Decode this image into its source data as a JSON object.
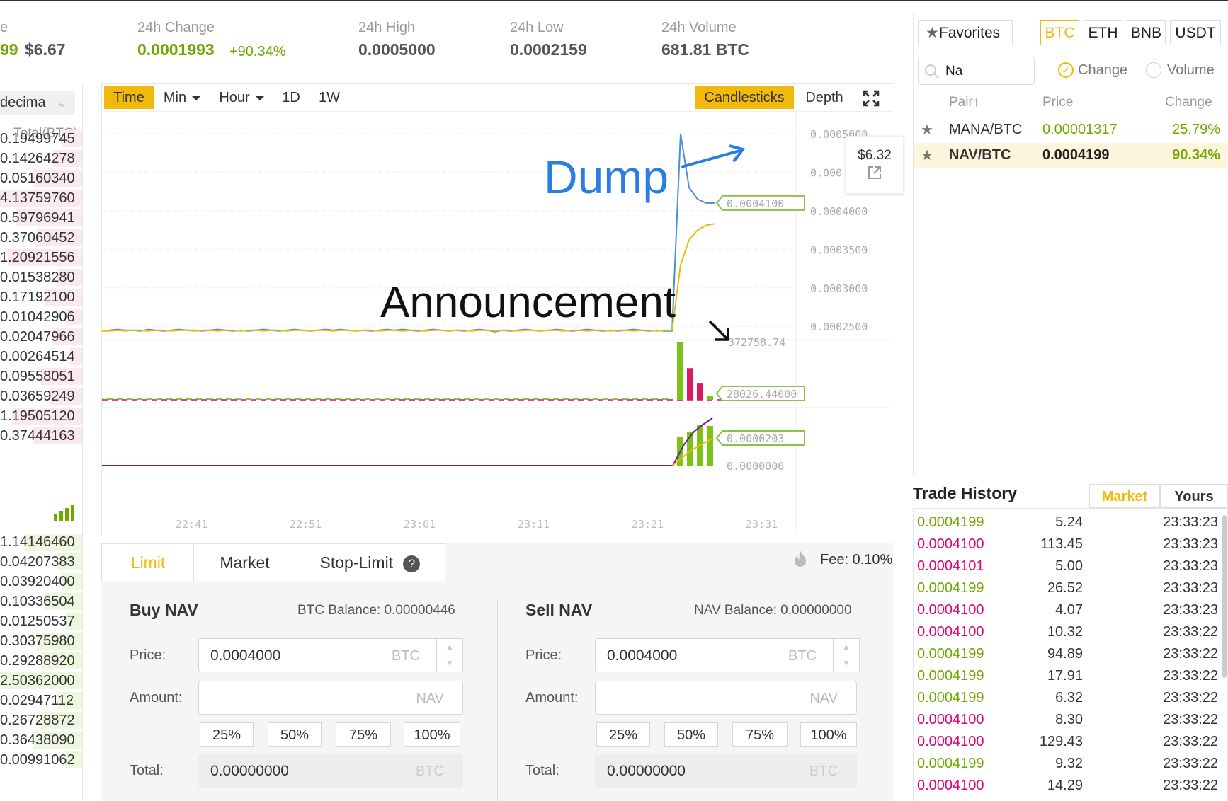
{
  "ticker": {
    "last_price_partial": "99",
    "last_price_usd": "$6.67",
    "change_label": "24h Change",
    "change_value": "0.0001993",
    "change_pct": "+90.34%",
    "high_label": "24h High",
    "high_value": "0.0005000",
    "low_label": "24h Low",
    "low_value": "0.0002159",
    "volume_label": "24h Volume",
    "volume_value": "681.81 BTC",
    "first_label_partial": "e"
  },
  "orderbook": {
    "decimals_label": "decima",
    "total_header": "Total(BTC)",
    "asks": [
      "0.19499745",
      "0.14264278",
      "0.05160340",
      "4.13759760",
      "0.59796941",
      "0.37060452",
      "1.20921556",
      "0.01538280",
      "0.17192100",
      "0.01042906",
      "0.02047966",
      "0.00264514",
      "0.09558051",
      "0.03659249",
      "1.19505120",
      "0.37444163"
    ],
    "bids": [
      "1.14146460",
      "0.04207383",
      "0.03920400",
      "0.10336504",
      "0.01250537",
      "0.30375980",
      "0.29288920",
      "2.50362000",
      "0.02947112",
      "0.26728872",
      "0.36438090",
      "0.00991062"
    ]
  },
  "chart_toolbar": {
    "time": "Time",
    "min": "Min",
    "hour": "Hour",
    "d1": "1D",
    "w1": "1W",
    "candlesticks": "Candlesticks",
    "depth": "Depth",
    "fullscreen_icon": "expand-icon"
  },
  "chart_data": {
    "type": "line",
    "x_ticks": [
      "22:41",
      "22:51",
      "23:01",
      "23:11",
      "23:21",
      "23:31"
    ],
    "price_ticks": [
      "0.0005000",
      "0.000",
      "0.0004000",
      "0.0003500",
      "0.0003000",
      "0.0002500"
    ],
    "price_ylim": [
      0.00023,
      0.00051
    ],
    "series": [
      {
        "color": "#4a90d9",
        "values": [
          0.000244,
          0.000245,
          0.000246,
          0.000245,
          0.000245,
          0.000244,
          0.000246,
          0.000245,
          0.000244,
          0.000245,
          0.000246,
          0.000245,
          0.000245,
          0.000244,
          0.000245,
          0.000246,
          0.000245,
          0.000244,
          0.000245,
          0.000244,
          0.000245,
          0.000246,
          0.000245,
          0.000244,
          0.000245,
          0.000246,
          0.000245,
          0.000244,
          0.000245,
          0.000246,
          0.000245,
          0.000246,
          0.000245,
          0.000244,
          0.000245,
          0.000244,
          0.000245,
          0.000246,
          0.000245,
          0.000246,
          0.000245,
          0.000244,
          0.000245,
          0.000246,
          0.000245,
          0.000244,
          0.000245,
          0.000244,
          0.000245,
          0.000246,
          0.000245,
          0.000243,
          0.000245,
          0.000244,
          0.000245,
          0.000246,
          0.000245,
          0.000244,
          0.000245,
          0.000246,
          0.000245,
          0.000244,
          0.000245,
          0.000246,
          0.000245,
          0.000244,
          0.000245,
          0.000244,
          0.000245,
          0.000246,
          0.000245,
          0.000244,
          0.000245,
          0.000244,
          0.000244,
          0.0005,
          0.00043,
          0.000415,
          0.00041,
          0.00041
        ]
      },
      {
        "color": "#f0b90b",
        "values": [
          0.000244,
          0.000244,
          0.000245,
          0.000244,
          0.000245,
          0.000245,
          0.000244,
          0.000245,
          0.000245,
          0.000244,
          0.000245,
          0.000245,
          0.000244,
          0.000245,
          0.000245,
          0.000244,
          0.000245,
          0.000245,
          0.000244,
          0.000245,
          0.000245,
          0.000244,
          0.000245,
          0.000245,
          0.000244,
          0.000245,
          0.000245,
          0.000244,
          0.000245,
          0.000245,
          0.000244,
          0.000245,
          0.000245,
          0.000244,
          0.000245,
          0.000245,
          0.000244,
          0.000245,
          0.000245,
          0.000244,
          0.000245,
          0.000245,
          0.000244,
          0.000245,
          0.000245,
          0.000244,
          0.000245,
          0.000245,
          0.000244,
          0.000245,
          0.000245,
          0.000244,
          0.000245,
          0.000245,
          0.000244,
          0.000245,
          0.000245,
          0.000244,
          0.000245,
          0.000245,
          0.000244,
          0.000245,
          0.000245,
          0.000244,
          0.000245,
          0.000245,
          0.000244,
          0.000245,
          0.000245,
          0.000244,
          0.000245,
          0.000245,
          0.000244,
          0.000245,
          0.000245,
          0.00033,
          0.000362,
          0.000375,
          0.000381,
          0.000383
        ]
      }
    ],
    "current_price_label": "0.0004100",
    "volume_ticks": [
      "372758.74",
      "28026.44000"
    ],
    "volume_bars": [
      372758.74,
      206000,
      110000,
      28026.44
    ],
    "indicator_ticks": [
      "0.0000203",
      "0.0000000"
    ],
    "tooltip_price": "$6.32",
    "annotation_dump": "Dump",
    "annotation_announcement": "Announcement"
  },
  "order_form": {
    "tabs": [
      "Limit",
      "Market",
      "Stop-Limit"
    ],
    "help_icon": "?",
    "fee": "Fee: 0.10%",
    "buy": {
      "title": "Buy NAV",
      "balance": "BTC Balance: 0.00000446",
      "price_label": "Price:",
      "price": "0.0004000",
      "price_unit": "BTC",
      "amount_label": "Amount:",
      "amount_unit": "NAV",
      "total_label": "Total:",
      "total": "0.00000000",
      "total_unit": "BTC"
    },
    "sell": {
      "title": "Sell NAV",
      "balance": "NAV Balance: 0.00000000",
      "price_label": "Price:",
      "price": "0.0004000",
      "price_unit": "BTC",
      "amount_label": "Amount:",
      "amount_unit": "NAV",
      "total_label": "Total:",
      "total": "0.00000000",
      "total_unit": "BTC"
    },
    "percents": [
      "25%",
      "50%",
      "75%",
      "100%"
    ]
  },
  "market_panel": {
    "favorites": "Favorites",
    "markets": [
      "BTC",
      "ETH",
      "BNB",
      "USDT"
    ],
    "search_value": "Na",
    "change_radio": "Change",
    "volume_radio": "Volume",
    "headers": {
      "pair": "Pair",
      "price": "Price",
      "change": "Change"
    },
    "rows": [
      {
        "pair": "MANA/BTC",
        "price": "0.00001317",
        "change": "25.79%"
      },
      {
        "pair": "NAV/BTC",
        "price": "0.0004199",
        "change": "90.34%"
      }
    ]
  },
  "trade_history": {
    "title": "Trade History",
    "tabs": [
      "Market",
      "Yours"
    ],
    "rows": [
      {
        "price": "0.0004199",
        "amount": "5.24",
        "time": "23:33:23",
        "side": "buy"
      },
      {
        "price": "0.0004100",
        "amount": "113.45",
        "time": "23:33:23",
        "side": "sell"
      },
      {
        "price": "0.0004101",
        "amount": "5.00",
        "time": "23:33:23",
        "side": "sell"
      },
      {
        "price": "0.0004199",
        "amount": "26.52",
        "time": "23:33:23",
        "side": "buy"
      },
      {
        "price": "0.0004100",
        "amount": "4.07",
        "time": "23:33:23",
        "side": "sell"
      },
      {
        "price": "0.0004100",
        "amount": "10.32",
        "time": "23:33:22",
        "side": "sell"
      },
      {
        "price": "0.0004199",
        "amount": "94.89",
        "time": "23:33:22",
        "side": "buy"
      },
      {
        "price": "0.0004199",
        "amount": "17.91",
        "time": "23:33:22",
        "side": "buy"
      },
      {
        "price": "0.0004199",
        "amount": "6.32",
        "time": "23:33:22",
        "side": "buy"
      },
      {
        "price": "0.0004100",
        "amount": "8.30",
        "time": "23:33:22",
        "side": "sell"
      },
      {
        "price": "0.0004100",
        "amount": "129.43",
        "time": "23:33:22",
        "side": "sell"
      },
      {
        "price": "0.0004199",
        "amount": "9.32",
        "time": "23:33:22",
        "side": "buy"
      },
      {
        "price": "0.0004100",
        "amount": "14.29",
        "time": "23:33:22",
        "side": "sell"
      }
    ]
  },
  "colors": {
    "accent": "#f0b90b",
    "buy": "#70a800",
    "sell": "#e0007a",
    "blue_line": "#4a90d9",
    "annotation_blue": "#2a7de1"
  }
}
